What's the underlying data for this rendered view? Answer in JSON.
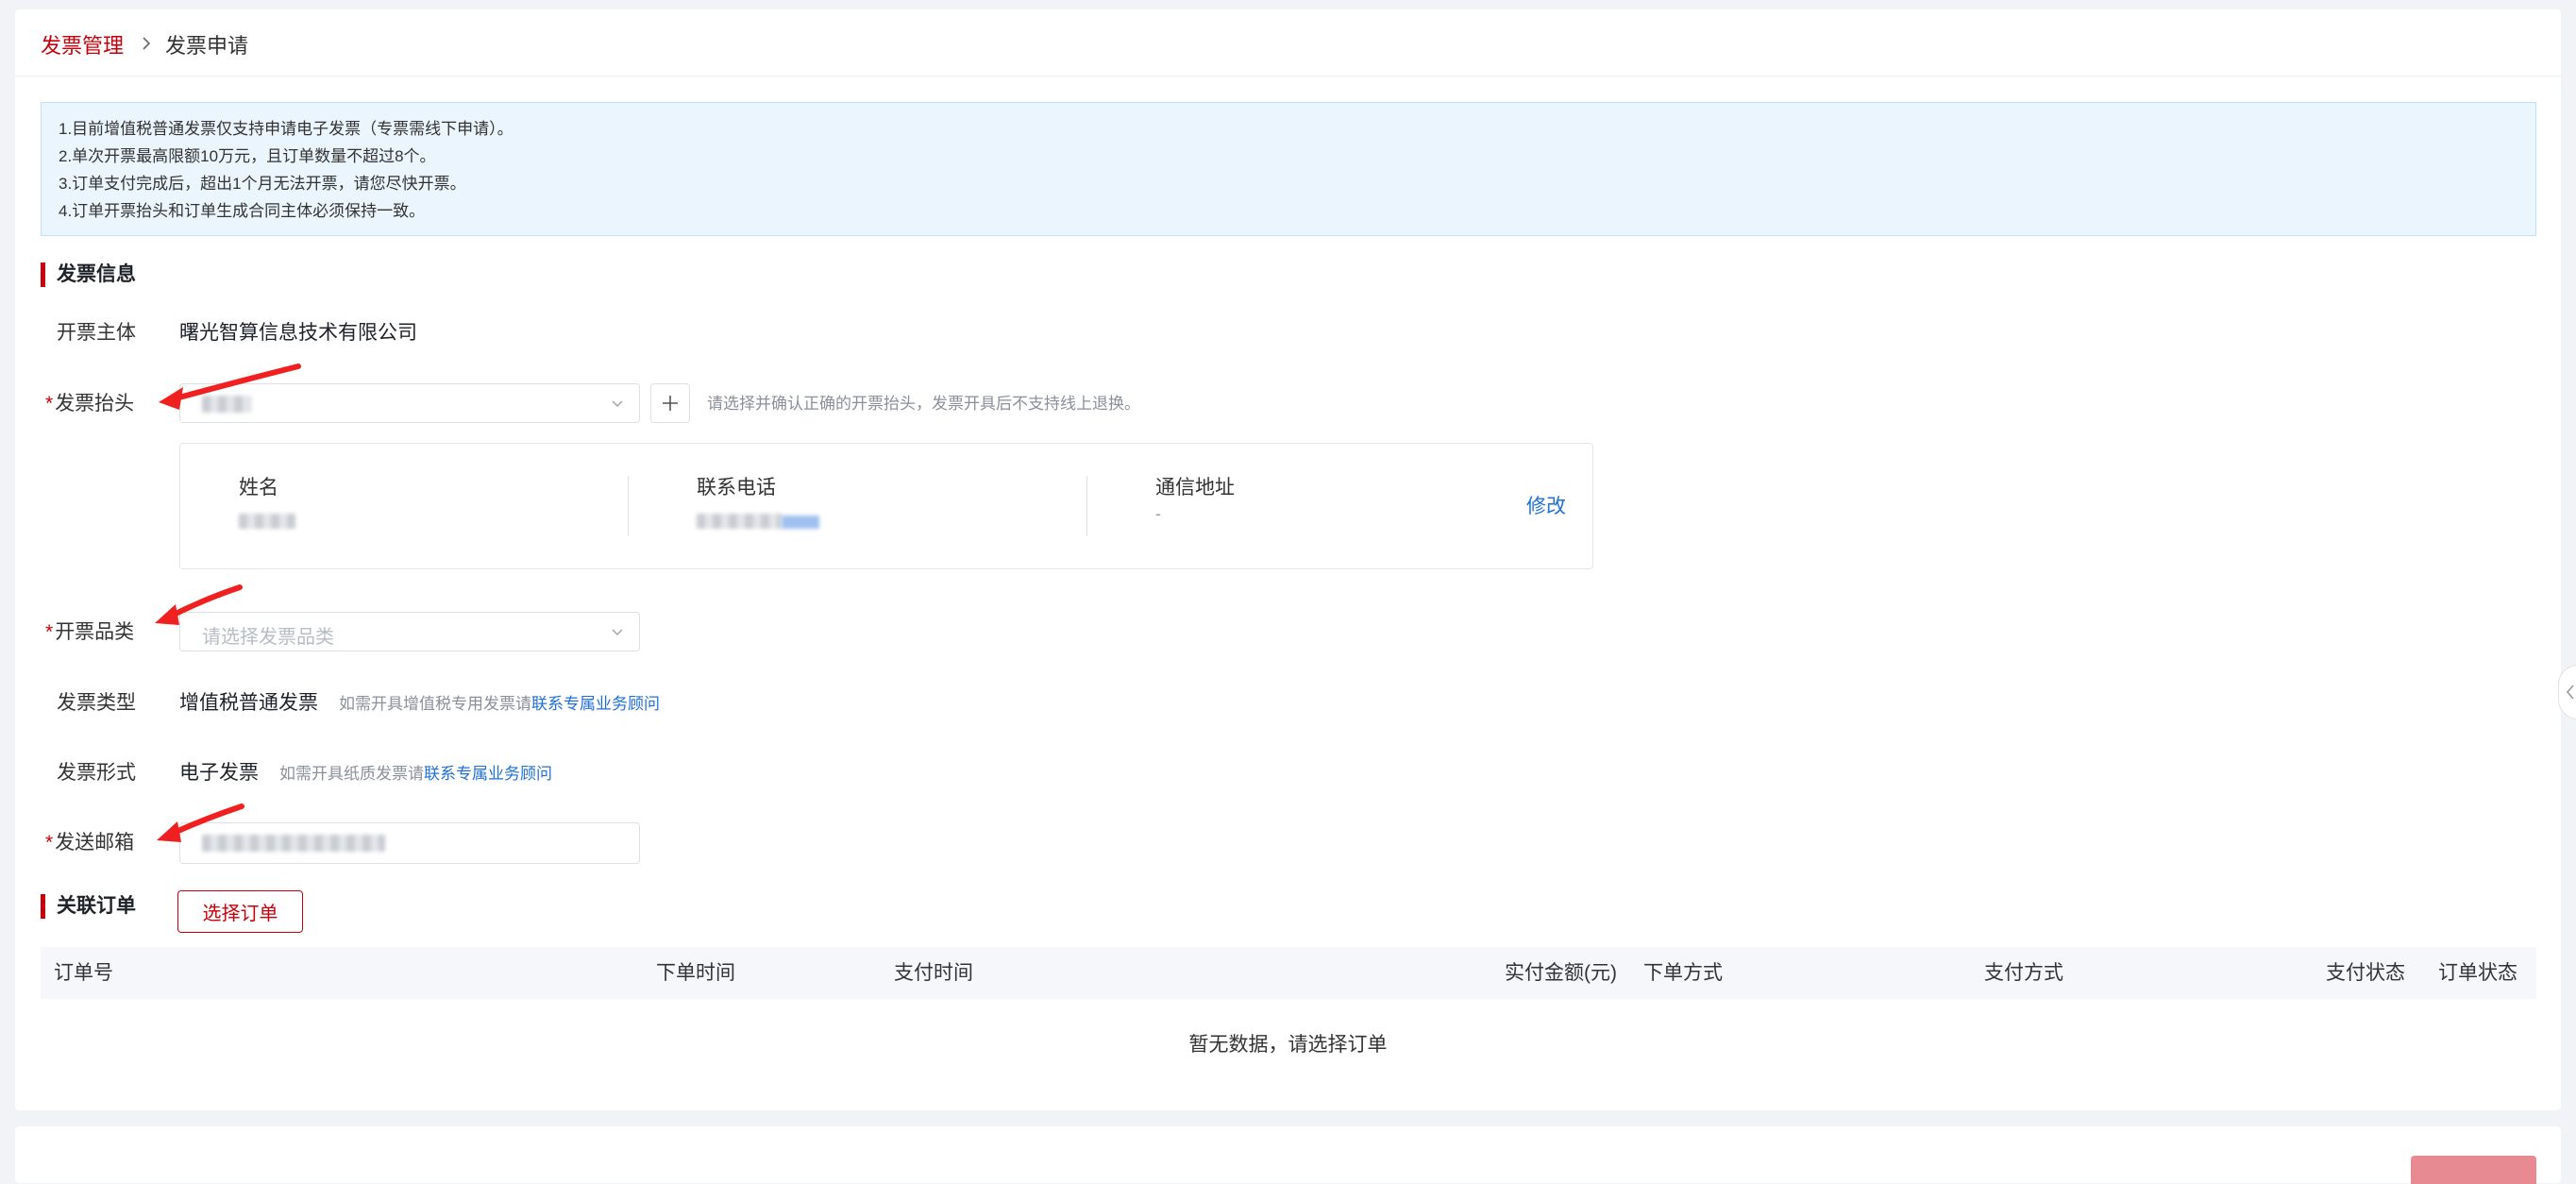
{
  "breadcrumb": {
    "parent": "发票管理",
    "current": "发票申请"
  },
  "notice": {
    "lines": [
      "1.目前增值税普通发票仅支持申请电子发票（专票需线下申请）。",
      "2.单次开票最高限额10万元，且订单数量不超过8个。",
      "3.订单支付完成后，超出1个月无法开票，请您尽快开票。",
      "4.订单开票抬头和订单生成合同主体必须保持一致。"
    ]
  },
  "invoice_info": {
    "section_title": "发票信息",
    "issuer_label": "开票主体",
    "issuer_value": "曙光智算信息技术有限公司",
    "header_label": "发票抬头",
    "header_hint": "请选择并确认正确的开票抬头，发票开具后不支持线上退换。",
    "contact": {
      "name_label": "姓名",
      "phone_label": "联系电话",
      "address_label": "通信地址",
      "address_value": "-",
      "edit_label": "修改"
    },
    "category_label": "开票品类",
    "category_placeholder": "请选择发票品类",
    "type_label": "发票类型",
    "type_value": "增值税普通发票",
    "type_hint": "如需开具增值税专用发票请",
    "type_link": "联系专属业务顾问",
    "form_label": "发票形式",
    "form_value": "电子发票",
    "form_hint": "如需开具纸质发票请",
    "form_link": "联系专属业务顾问",
    "email_label": "发送邮箱"
  },
  "orders": {
    "section_title": "关联订单",
    "choose_button": "选择订单",
    "columns": [
      "订单号",
      "下单时间",
      "支付时间",
      "实付金额(元)",
      "下单方式",
      "支付方式",
      "支付状态",
      "订单状态"
    ],
    "empty_text": "暂无数据，请选择订单"
  },
  "colors": {
    "brand": "#c7000b",
    "link": "#1f6fd9",
    "notice_bg": "#eaf5fe"
  }
}
